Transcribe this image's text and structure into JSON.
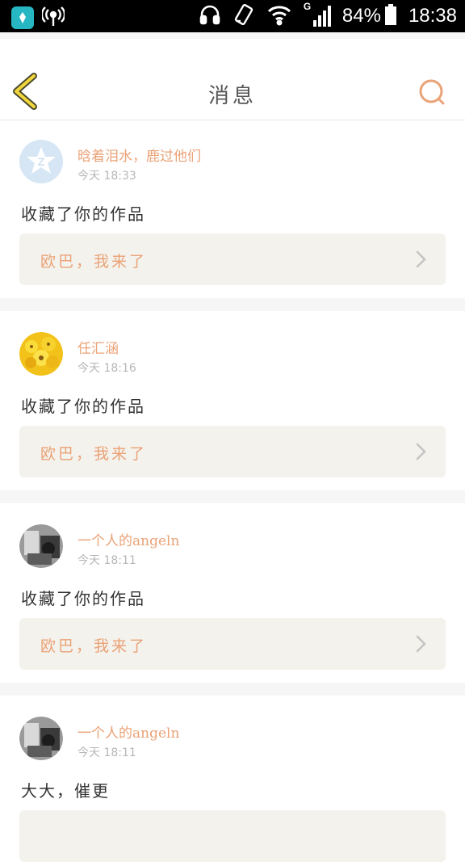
{
  "status_bar": {
    "battery": "84%",
    "time": "18:38",
    "network": "G",
    "icons": [
      "app-icon",
      "hotspot-icon",
      "headphones-icon",
      "rotate-icon",
      "wifi-icon",
      "signal-icon",
      "battery-icon"
    ]
  },
  "header": {
    "title": "消息",
    "back_icon": "chevron-left-icon",
    "search_icon": "search-icon",
    "accent_color": "#eaa277"
  },
  "messages": [
    {
      "name": "晗着泪水，鹿过他们",
      "time": "今天 18:33",
      "text": "收藏了你的作品",
      "quote": "欧巴，我来了",
      "avatar": "qq-default-avatar"
    },
    {
      "name": "任汇涵",
      "time": "今天 18:16",
      "text": "收藏了你的作品",
      "quote": "欧巴，我来了",
      "avatar": "sunflower-avatar"
    },
    {
      "name": "一个人的angeln",
      "time": "今天 18:11",
      "text": "收藏了你的作品",
      "quote": "欧巴，我来了",
      "avatar": "monochrome-photo-avatar"
    },
    {
      "name": "一个人的angeln",
      "time": "今天 18:11",
      "text": "大大，催更",
      "quote": "",
      "avatar": "monochrome-photo-avatar"
    }
  ]
}
